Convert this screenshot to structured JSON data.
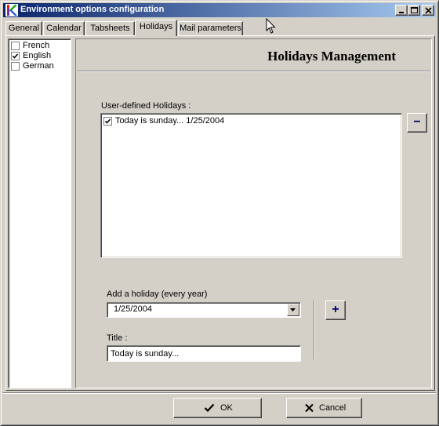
{
  "window": {
    "title": "Environment options configuration"
  },
  "tabs": [
    {
      "label": "General"
    },
    {
      "label": "Calendar"
    },
    {
      "label": "Tabsheets"
    },
    {
      "label": "Holidays",
      "active": true
    },
    {
      "label": "Mail parameters"
    }
  ],
  "languages": [
    {
      "label": "French",
      "checked": false
    },
    {
      "label": "English",
      "checked": true
    },
    {
      "label": "German",
      "checked": false
    }
  ],
  "holidays_panel": {
    "heading": "Holidays Management",
    "list_label": "User-defined Holidays :",
    "items": [
      {
        "label": "Today is sunday... 1/25/2004",
        "checked": true
      }
    ],
    "remove_label": "−",
    "add_label": "Add a holiday (every year)",
    "date_value": "1/25/2004",
    "add_button_label": "+",
    "title_label": "Title :",
    "title_value": "Today is sunday..."
  },
  "footer": {
    "ok_label": "OK",
    "cancel_label": "Cancel"
  },
  "colors": {
    "title_start": "#0a246a",
    "title_end": "#a6caf0",
    "face": "#d4d0c8",
    "accent_button_text": "#00006b"
  }
}
